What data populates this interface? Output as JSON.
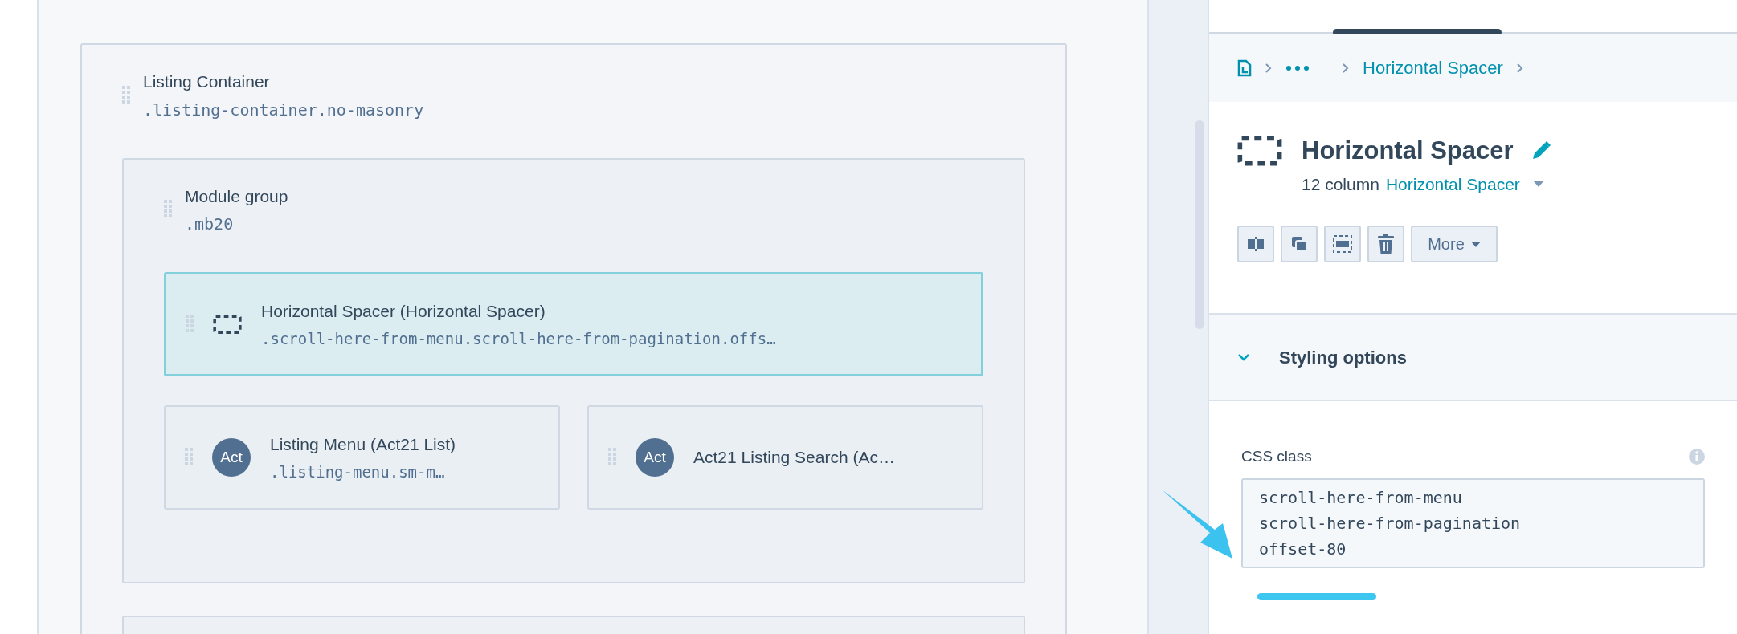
{
  "canvas": {
    "listing_container": {
      "title": "Listing Container",
      "class": ".listing-container.no-masonry",
      "module_group": {
        "title": "Module group",
        "class": ".mb20",
        "rows": [
          {
            "modules": [
              {
                "kind": "spacer",
                "selected": true,
                "title": "Horizontal Spacer (Horizontal Spacer)",
                "class": ".scroll-here-from-menu.scroll-here-from-pagination.offs…"
              }
            ]
          },
          {
            "modules": [
              {
                "kind": "custom",
                "badge": "Act",
                "selected": false,
                "title": "Listing Menu (Act21 List)",
                "class": ".listing-menu.sm-m…"
              },
              {
                "kind": "custom",
                "badge": "Act",
                "selected": false,
                "title": "Act21 Listing Search (Ac…"
              }
            ]
          }
        ]
      }
    }
  },
  "inspector": {
    "breadcrumb": {
      "current": "Horizontal Spacer"
    },
    "header": {
      "title": "Horizontal Spacer",
      "width": "12 column",
      "module_link": "Horizontal Spacer"
    },
    "actions": [
      {
        "kind": "split"
      },
      {
        "kind": "clone"
      },
      {
        "kind": "select"
      },
      {
        "kind": "delete"
      }
    ],
    "more_button": "More",
    "section": {
      "title": "Styling options",
      "expanded": true
    },
    "field": {
      "label": "CSS class",
      "value": "scroll-here-from-menu\nscroll-here-from-pagination\noffset-80"
    }
  }
}
